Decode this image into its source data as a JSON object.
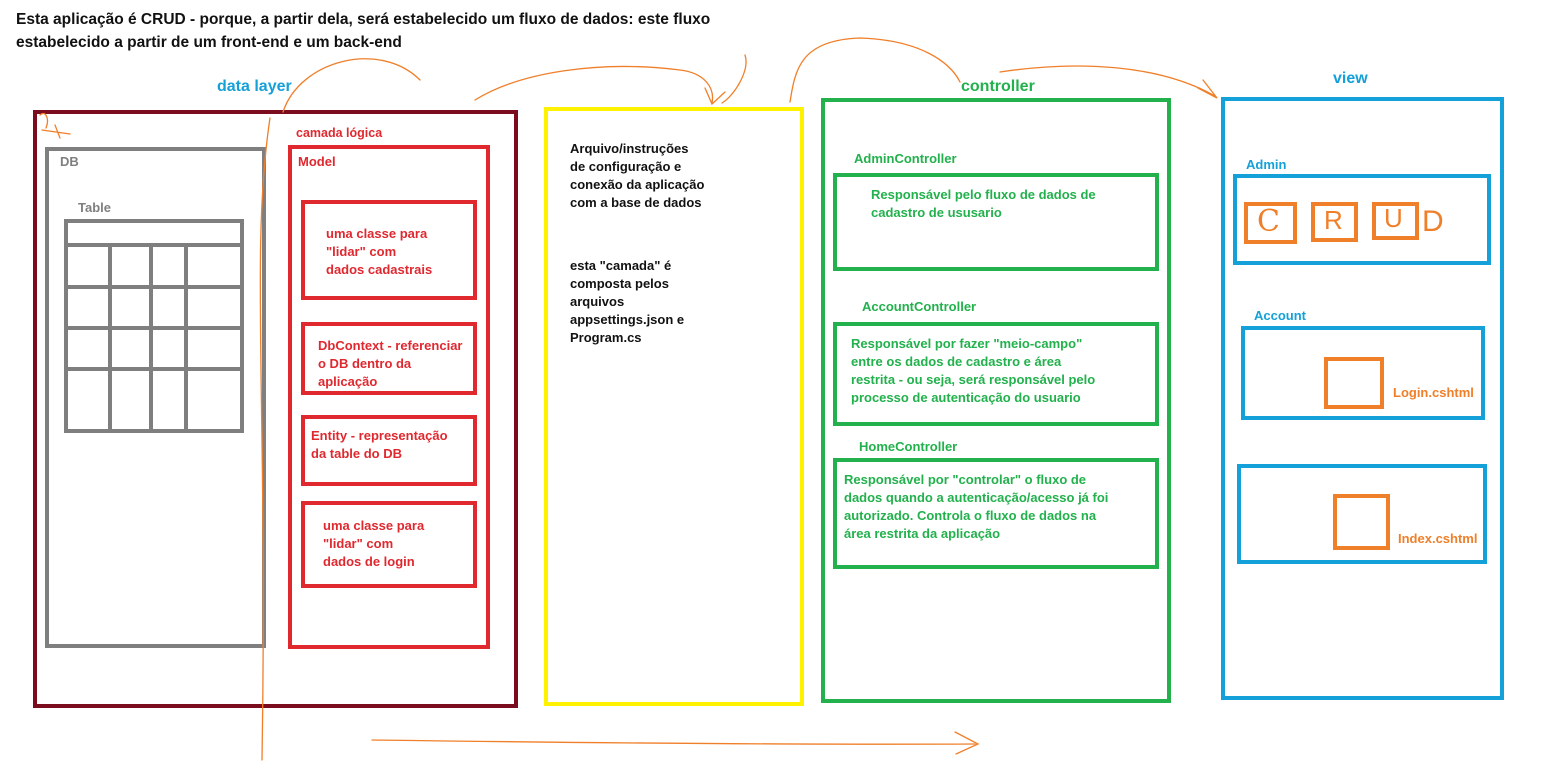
{
  "intro": "Esta aplicação é CRUD - porque, a partir dela, será estabelecido um fluxo de dados: este fluxo\nestabelecido a partir de um front-end e um back-end",
  "data_layer": {
    "title": "data layer",
    "db_label": "DB",
    "table_label": "Table",
    "logic_label": "camada lógica",
    "model_label": "Model",
    "model_items": [
      "uma classe para\n\"lidar\" com\ndados cadastrais",
      "DbContext - referenciar\no DB dentro da\naplicação",
      "Entity - representação\nda table do DB",
      "uma classe para\n\"lidar\" com\ndados de login"
    ]
  },
  "config": {
    "text1": "Arquivo/instruções\nde configuração e\nconexão da aplicação\ncom a base de dados",
    "text2": "esta \"camada\" é\ncomposta pelos\narquivos\nappsettings.json e\nProgram.cs"
  },
  "controller": {
    "title": "controller",
    "items": [
      {
        "name": "AdminController",
        "desc": "Responsável pelo fluxo de dados de\ncadastro de ususario"
      },
      {
        "name": "AccountController",
        "desc": "Responsável por fazer \"meio-campo\"\nentre os dados de cadastro e área\nrestrita - ou seja, será responsável pelo\nprocesso de autenticação do usuario"
      },
      {
        "name": "HomeController",
        "desc": "Responsável por \"controlar\"  o fluxo de\ndados quando a autenticação/acesso já foi\nautorizado. Controla o fluxo de dados na\nárea restrita da aplicação"
      }
    ]
  },
  "view": {
    "title": "view",
    "admin_label": "Admin",
    "crud_letters": [
      "C",
      "R",
      "U",
      "D"
    ],
    "account_label": "Account",
    "login_file": "Login.cshtml",
    "index_file": "Index.cshtml"
  },
  "colors": {
    "maroon": "#7b0c1e",
    "grey": "#7f7f7f",
    "red": "#e0282f",
    "yellow": "#fff200",
    "green": "#22b14c",
    "blue": "#14a0d8",
    "orange": "#f07f2a"
  }
}
